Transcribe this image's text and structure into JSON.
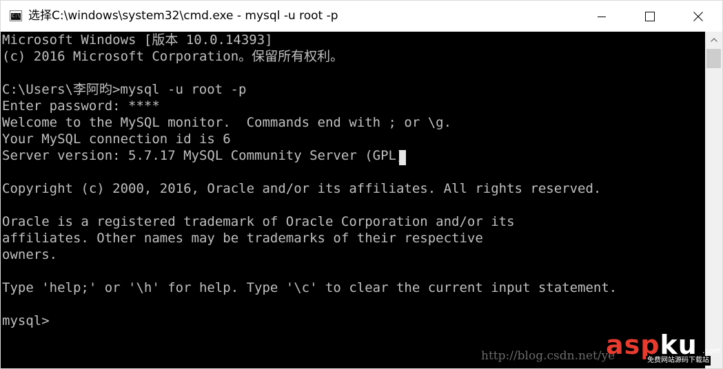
{
  "window": {
    "title": "选择C:\\windows\\system32\\cmd.exe - mysql  -u root -p",
    "icon": "cmd-console-icon",
    "controls": {
      "minimize_icon": "minimize-icon",
      "maximize_icon": "maximize-icon",
      "close_icon": "close-icon"
    },
    "app_icon_prompt": "C:\\"
  },
  "console": {
    "background": "#000000",
    "foreground": "#c0c0c0",
    "lines": [
      "Microsoft Windows [版本 10.0.14393]",
      "(c) 2016 Microsoft Corporation。保留所有权利。",
      "",
      "C:\\Users\\李阿昀>mysql -u root -p",
      "Enter password: ****",
      "Welcome to the MySQL monitor.  Commands end with ; or \\g.",
      "Your MySQL connection id is 6",
      "Server version: 5.7.17 MySQL Community Server (GPL)",
      "",
      "Copyright (c) 2000, 2016, Oracle and/or its affiliates. All rights reserved.",
      "",
      "Oracle is a registered trademark of Oracle Corporation and/or its",
      "affiliates. Other names may be trademarks of their respective",
      "owners.",
      "",
      "Type 'help;' or '\\h' for help. Type '\\c' to clear the current input statement.",
      "",
      "mysql>"
    ]
  },
  "scrollbar": {
    "up_icon": "scroll-up-arrow-icon"
  },
  "watermark": {
    "url": "http://blog.csdn.net/ye",
    "logo_asp": "asp",
    "logo_ku": "ku",
    "logo_com": ".com",
    "logo_tagline": "免费网站源码下载站"
  }
}
